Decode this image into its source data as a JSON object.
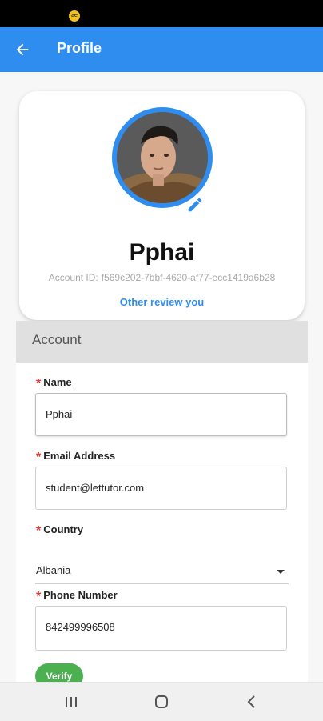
{
  "status_bar": {
    "app_icon": "ae"
  },
  "app_bar": {
    "title": "Profile",
    "back_icon": "arrow-left-icon"
  },
  "profile": {
    "name": "Pphai",
    "account_id_label": "Account ID:",
    "account_id": "f569c202-7bbf-4620-af77-ecc1419a6b28",
    "review_link": "Other review you",
    "edit_icon": "pencil-icon"
  },
  "section": {
    "title": "Account"
  },
  "form": {
    "name_label": "Name",
    "name_value": "Pphai",
    "email_label": "Email Address",
    "email_value": "student@lettutor.com",
    "country_label": "Country",
    "country_value": "Albania",
    "phone_label": "Phone Number",
    "phone_value": "842499996508",
    "verify_label": "Verify",
    "required_mark": "*"
  },
  "nav_bar": {
    "icons": [
      "recent-apps-icon",
      "home-icon",
      "back-icon"
    ]
  },
  "colors": {
    "primary": "#2f8df0",
    "required": "#e53935",
    "verify": "#4caf50",
    "section_header": "#e0e0e0"
  }
}
